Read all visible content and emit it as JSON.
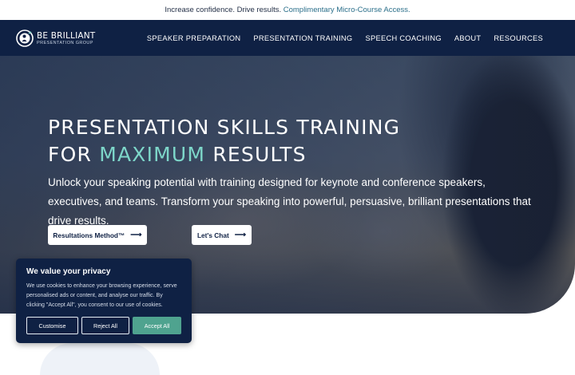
{
  "announcement": {
    "text": "Increase confidence. Drive results.",
    "link": "Complimentary Micro-Course Access."
  },
  "brand": {
    "name": "BE BRILLIANT",
    "tagline": "PRESENTATION GROUP"
  },
  "nav": {
    "items": [
      "SPEAKER PREPARATION",
      "PRESENTATION TRAINING",
      "SPEECH COACHING",
      "ABOUT",
      "RESOURCES"
    ]
  },
  "hero": {
    "headline_line1": "PRESENTATION SKILLS TRAINING",
    "headline_line2_prefix": "FOR",
    "headline_line2_accent": "MAXIMUM",
    "headline_line2_suffix": "RESULTS",
    "subtext": "Unlock your speaking potential with training designed for keynote and conference speakers, executives, and teams. Transform your speaking into powerful, persuasive, brilliant presentations that drive results.",
    "cta_primary": "Resultations Method™",
    "cta_secondary": "Let's Chat"
  },
  "cookie_banner": {
    "title": "We value your privacy",
    "body": "We use cookies to enhance your browsing experience, serve personalised ads or content, and analyse our traffic. By clicking \"Accept All\", you consent to our use of cookies.",
    "customise": "Customise",
    "reject": "Reject All",
    "accept": "Accept All"
  },
  "colors": {
    "navy": "#0f2144",
    "accent_teal": "#7dd6c9",
    "accept_green": "#4fa38f"
  },
  "icons": {
    "logo": "person-circle-logo-icon",
    "arrow": "arrow-right-icon"
  }
}
